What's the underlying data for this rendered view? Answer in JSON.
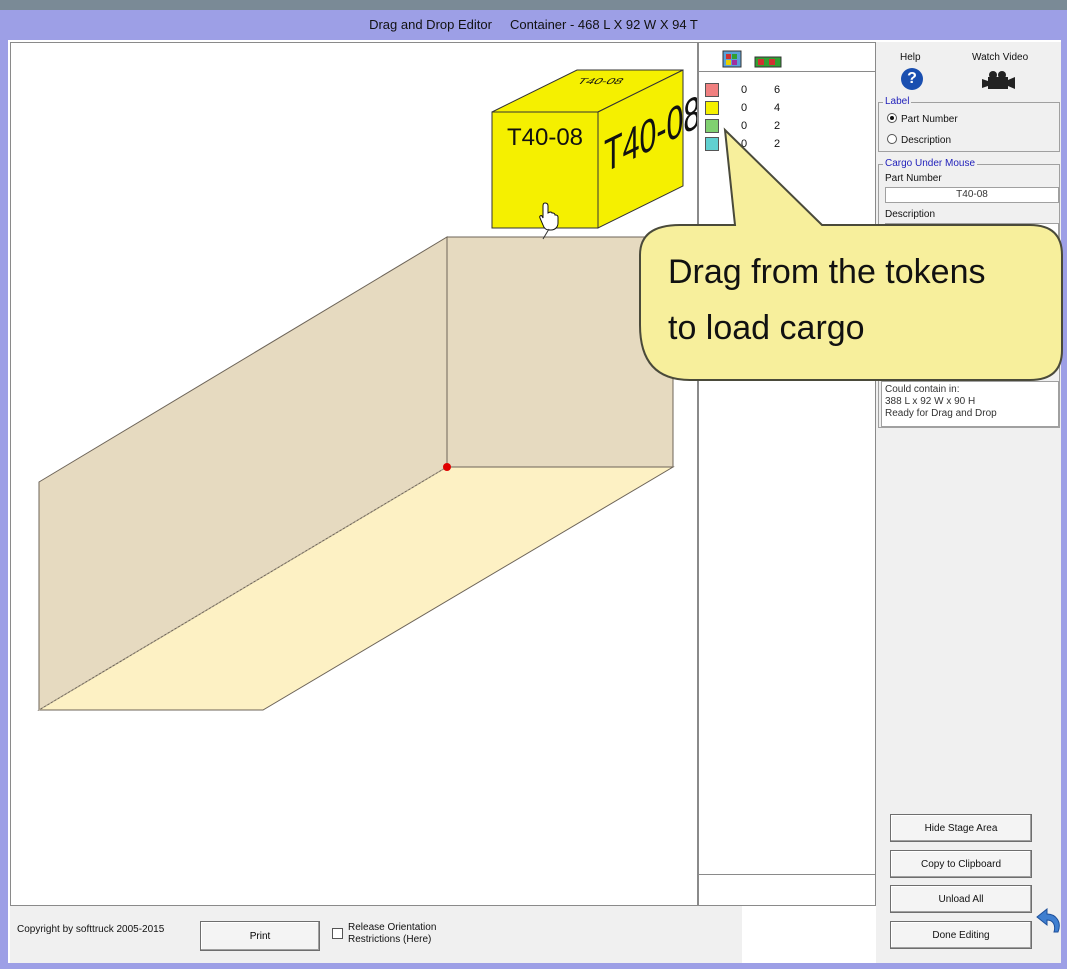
{
  "window": {
    "title_app": "Drag and Drop Editor",
    "title_container": "Container - 468 L X 92 W X 94 T"
  },
  "cargo": {
    "top_label": "T40-08",
    "front_label": "T40-08",
    "side_label": "T40-08"
  },
  "tokens": [
    {
      "color": "#f08080",
      "loaded": "0",
      "count": "6"
    },
    {
      "color": "#f5f000",
      "loaded": "0",
      "count": "4"
    },
    {
      "color": "#80d070",
      "loaded": "0",
      "count": "2"
    },
    {
      "color": "#60d0d0",
      "loaded": "0",
      "count": "2"
    }
  ],
  "side": {
    "help_label": "Help",
    "video_label": "Watch Video",
    "label_group": "Label",
    "radio_part": "Part Number",
    "radio_desc": "Description",
    "cargo_group": "Cargo Under Mouse",
    "part_number_label": "Part Number",
    "part_number_value": "T40-08",
    "description_label": "Description",
    "status_line1": "Could contain in:",
    "status_line2": "388 L x 92 W x 90 H",
    "status_line3": "Ready for Drag and Drop"
  },
  "buttons": {
    "hide_stage": "Hide Stage Area",
    "copy_clipboard": "Copy to Clipboard",
    "unload_all": "Unload All",
    "done_editing": "Done Editing"
  },
  "bottom": {
    "copyright": "Copyright by softtruck 2005-2015",
    "print": "Print",
    "release_line1": "Release Orientation",
    "release_line2": "Restrictions (Here)"
  },
  "callout": {
    "line1": "Drag from the tokens",
    "line2": "to load cargo"
  },
  "colors": {
    "frame": "#9d9fe6",
    "container_side": "#e6dac0",
    "container_floor": "#fdf1c4",
    "cargo_fill": "#f5f000",
    "callout_fill": "#f7ef9c"
  }
}
